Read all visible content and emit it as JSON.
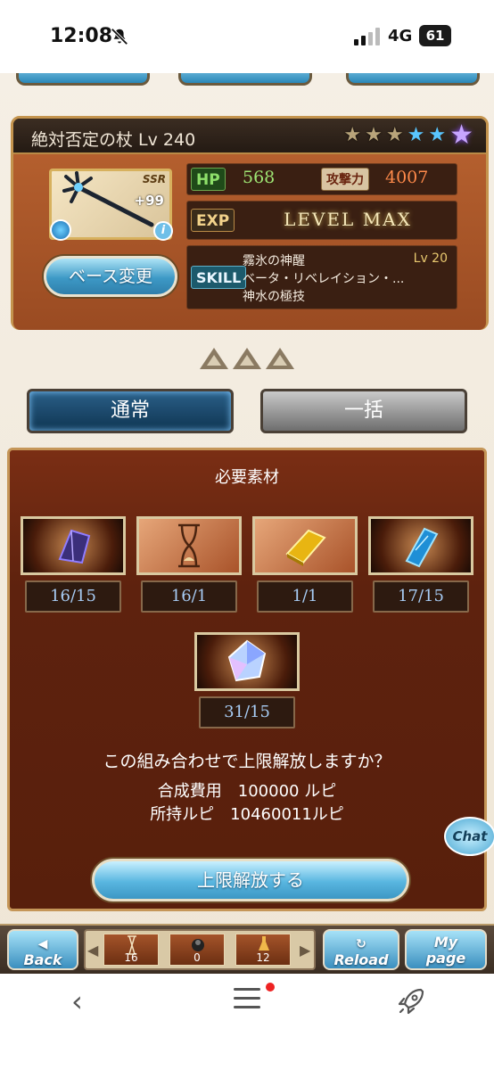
{
  "status": {
    "time": "12:08",
    "network": "4G",
    "battery": "61"
  },
  "weapon": {
    "name": "絶対否定の杖 Lv 240",
    "rarity": "SSR",
    "plus": "+99",
    "hp_label": "HP",
    "hp": "568",
    "atk_label": "攻撃力",
    "atk": "4007",
    "exp_label": "EXP",
    "exp_value": "LEVEL MAX",
    "skill_label": "SKILL",
    "skill_name": "霧氷の神醒",
    "skill_level": "Lv 20",
    "skill_line2": "ベータ・リベレイション・...",
    "skill_line3": "神水の極技",
    "base_button": "ベース変更"
  },
  "tabs": {
    "normal": "通常",
    "bulk": "一括"
  },
  "materials": {
    "title": "必要素材",
    "items": [
      {
        "icon": "dark-crystal-icon",
        "count": "16/15"
      },
      {
        "icon": "hourglass-icon",
        "count": "16/1"
      },
      {
        "icon": "gold-bar-icon",
        "count": "1/1"
      },
      {
        "icon": "blue-tablet-icon",
        "count": "17/15"
      },
      {
        "icon": "prism-gem-icon",
        "count": "31/15"
      }
    ]
  },
  "confirm_text": "この組み合わせで上限解放しますか？",
  "cost_text": "合成費用　100000 ルピ",
  "owned_text": "所持ルピ　10460011ルピ",
  "execute_button": "上限解放する",
  "chat_label": "Chat",
  "game_nav": {
    "back": "Back",
    "reload": "Reload",
    "mypage_1": "My",
    "mypage_2": "page",
    "quick_items": [
      {
        "count": "16"
      },
      {
        "count": "0"
      },
      {
        "count": "12"
      }
    ]
  }
}
